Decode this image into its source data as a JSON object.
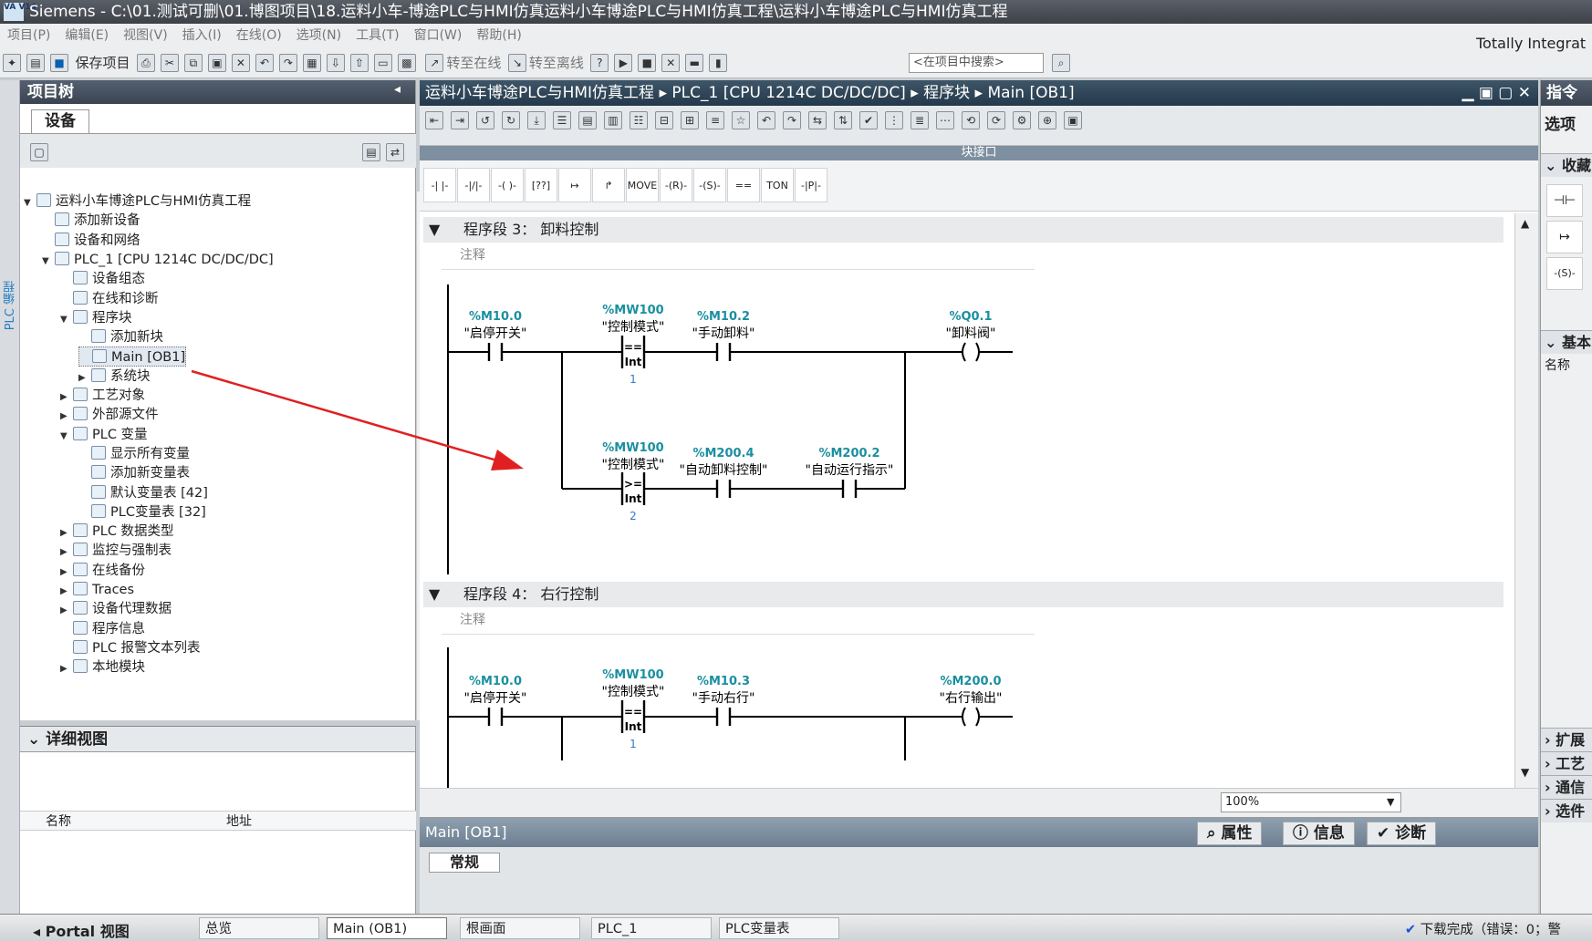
{
  "window": {
    "title": "Siemens  -  C:\\01.测试可删\\01.博图项目\\18.运料小车-博途PLC与HMI仿真运料小车博途PLC与HMI仿真工程\\运料小车博途PLC与HMI仿真工程",
    "logo": "VA\nV14",
    "brand": "Totally Integrat"
  },
  "menu": [
    "项目(P)",
    "编辑(E)",
    "视图(V)",
    "插入(I)",
    "在线(O)",
    "选项(N)",
    "工具(T)",
    "窗口(W)",
    "帮助(H)"
  ],
  "toolbar": {
    "save_label": "保存项目",
    "go_online": "转至在线",
    "go_offline": "转至离线",
    "search_placeholder": "<在项目中搜索>"
  },
  "project_tree": {
    "title": "项目树",
    "tab": "设备",
    "side_label": "PLC 编程",
    "items": [
      {
        "label": "运料小车博途PLC与HMI仿真工程",
        "level": 0,
        "arrow": "▼"
      },
      {
        "label": "添加新设备",
        "level": 1,
        "arrow": ""
      },
      {
        "label": "设备和网络",
        "level": 1,
        "arrow": ""
      },
      {
        "label": "PLC_1 [CPU 1214C DC/DC/DC]",
        "level": 1,
        "arrow": "▼"
      },
      {
        "label": "设备组态",
        "level": 2,
        "arrow": ""
      },
      {
        "label": "在线和诊断",
        "level": 2,
        "arrow": ""
      },
      {
        "label": "程序块",
        "level": 2,
        "arrow": "▼"
      },
      {
        "label": "添加新块",
        "level": 3,
        "arrow": ""
      },
      {
        "label": "Main [OB1]",
        "level": 3,
        "arrow": "",
        "selected": true
      },
      {
        "label": "系统块",
        "level": 3,
        "arrow": "▶"
      },
      {
        "label": "工艺对象",
        "level": 2,
        "arrow": "▶"
      },
      {
        "label": "外部源文件",
        "level": 2,
        "arrow": "▶"
      },
      {
        "label": "PLC 变量",
        "level": 2,
        "arrow": "▼"
      },
      {
        "label": "显示所有变量",
        "level": 3,
        "arrow": ""
      },
      {
        "label": "添加新变量表",
        "level": 3,
        "arrow": ""
      },
      {
        "label": "默认变量表 [42]",
        "level": 3,
        "arrow": ""
      },
      {
        "label": "PLC变量表 [32]",
        "level": 3,
        "arrow": ""
      },
      {
        "label": "PLC 数据类型",
        "level": 2,
        "arrow": "▶"
      },
      {
        "label": "监控与强制表",
        "level": 2,
        "arrow": "▶"
      },
      {
        "label": "在线备份",
        "level": 2,
        "arrow": "▶"
      },
      {
        "label": "Traces",
        "level": 2,
        "arrow": "▶"
      },
      {
        "label": "设备代理数据",
        "level": 2,
        "arrow": "▶"
      },
      {
        "label": "程序信息",
        "level": 2,
        "arrow": ""
      },
      {
        "label": "PLC 报警文本列表",
        "level": 2,
        "arrow": ""
      },
      {
        "label": "本地模块",
        "level": 2,
        "arrow": "▶"
      }
    ]
  },
  "detail_view": {
    "title": "详细视图",
    "col_name": "名称",
    "col_addr": "地址"
  },
  "editor": {
    "breadcrumb": "运料小车博途PLC与HMI仿真工程  ▸  PLC_1 [CPU 1214C DC/DC/DC]  ▸  程序块  ▸  Main [OB1]",
    "block_interface": "块接口",
    "zoom": "100%",
    "ladder_elements": [
      "-| |-",
      "-|/|-",
      "-( )-",
      "[??]",
      "↦",
      "↱",
      "MOVE",
      "-(R)-",
      "-(S)-",
      "==",
      "TON",
      "-|P|-"
    ]
  },
  "network3": {
    "title": "程序段 3：",
    "name": "卸料控制",
    "comment": "注释",
    "r1": {
      "c1": {
        "addr": "%M10.0",
        "name": "\"启停开关\""
      },
      "cmp": {
        "addr": "%MW100",
        "name": "\"控制模式\"",
        "op": "==",
        "type": "Int",
        "val": "1"
      },
      "c2": {
        "addr": "%M10.2",
        "name": "\"手动卸料\""
      },
      "coil": {
        "addr": "%Q0.1",
        "name": "\"卸料阀\""
      }
    },
    "r2": {
      "cmp": {
        "addr": "%MW100",
        "name": "\"控制模式\"",
        "op": ">=",
        "type": "Int",
        "val": "2"
      },
      "c1": {
        "addr": "%M200.4",
        "name": "\"自动卸料控制\""
      },
      "c2": {
        "addr": "%M200.2",
        "name": "\"自动运行指示\""
      }
    }
  },
  "network4": {
    "title": "程序段 4：",
    "name": "右行控制",
    "comment": "注释",
    "r1": {
      "c1": {
        "addr": "%M10.0",
        "name": "\"启停开关\""
      },
      "cmp": {
        "addr": "%MW100",
        "name": "\"控制模式\"",
        "op": "==",
        "type": "Int",
        "val": "1"
      },
      "c2": {
        "addr": "%M10.3",
        "name": "\"手动右行\""
      },
      "coil": {
        "addr": "%M200.0",
        "name": "\"右行输出\""
      }
    }
  },
  "inspector": {
    "title": "Main [OB1]",
    "tab_props": "属性",
    "tab_info": "信息",
    "tab_diag": "诊断",
    "general": "常规"
  },
  "right_pane": {
    "title": "指令",
    "options": "选项",
    "favorites": "收藏",
    "basic": "基本",
    "name_col": "名称",
    "extended": "扩展",
    "tech": "工艺",
    "comm": "通信",
    "optional": "选件"
  },
  "taskbar": {
    "portal": "Portal 视图",
    "items": [
      "总览",
      "Main (OB1)",
      "根画面",
      "PLC_1",
      "PLC变量表"
    ],
    "status": "下载完成（错误：0；警"
  }
}
